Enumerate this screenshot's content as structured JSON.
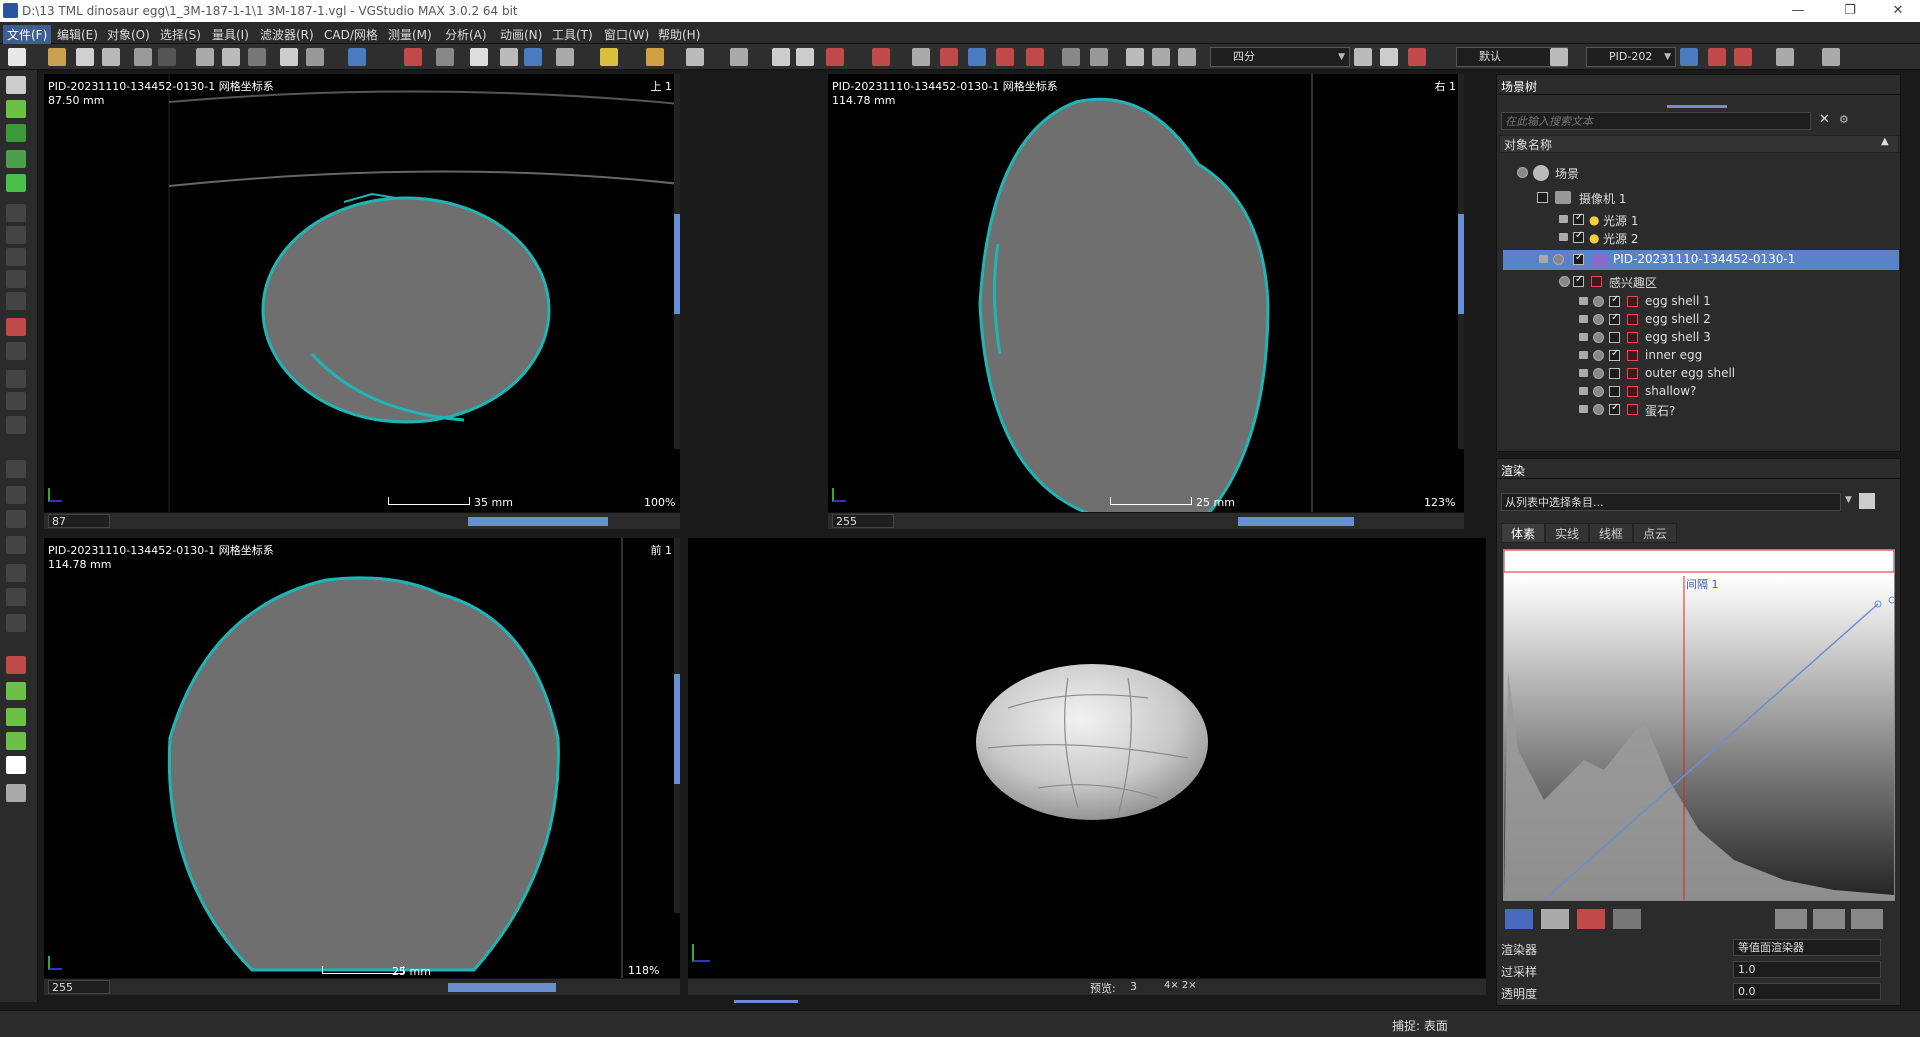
{
  "window": {
    "title": "D:\\13 TML dinosaur egg\\1_3M-187-1-1\\1 3M-187-1.vgl - VGStudio MAX 3.0.2 64 bit",
    "minimize": "—",
    "restore": "❐",
    "close": "✕"
  },
  "menu": [
    {
      "label": "文件(F)",
      "active": true
    },
    {
      "label": "编辑(E)"
    },
    {
      "label": "对象(O)"
    },
    {
      "label": "选择(S)"
    },
    {
      "label": "量具(I)"
    },
    {
      "label": "滤波器(R)"
    },
    {
      "label": "CAD/网格"
    },
    {
      "label": "测量(M)"
    },
    {
      "label": "分析(A)"
    },
    {
      "label": "动画(N)"
    },
    {
      "label": "工具(T)"
    },
    {
      "label": "窗口(W)"
    },
    {
      "label": "帮助(H)"
    }
  ],
  "toolbar": {
    "layout_select": "四分",
    "preset_select": "默认",
    "object_select": "PID-202"
  },
  "viewports": {
    "top": {
      "header": "PID-20231110-134452-0130-1 网格坐标系",
      "direction": "上 1",
      "distance": "87.50 mm",
      "scale": "35 mm",
      "zoom": "100%",
      "slice": "87"
    },
    "right": {
      "header": "PID-20231110-134452-0130-1 网格坐标系",
      "direction": "右 1",
      "distance": "114.78 mm",
      "scale": "25 mm",
      "zoom": "123%",
      "slice": "255"
    },
    "front": {
      "header": "PID-20231110-134452-0130-1 网格坐标系",
      "direction": "前 1",
      "distance": "114.78 mm",
      "scale": "25 mm",
      "zoom": "118%",
      "slice": "255"
    },
    "three_d": {
      "preview_label": "预览:",
      "preview_value": "3",
      "multiplier": "4× 2×"
    }
  },
  "scene_tree": {
    "title": "场景树",
    "search_placeholder": "在此输入搜索文本",
    "column": "对象名称",
    "items": [
      {
        "label": "场景",
        "type": "scene"
      },
      {
        "label": "摄像机 1",
        "type": "camera"
      },
      {
        "label": "光源 1",
        "type": "light",
        "checked": true
      },
      {
        "label": "光源 2",
        "type": "light",
        "checked": true
      },
      {
        "label": "PID-20231110-134452-0130-1",
        "type": "volume",
        "checked": true,
        "selected": true
      },
      {
        "label": "感兴趣区",
        "type": "roi-group",
        "checked": true
      },
      {
        "label": "egg shell 1",
        "type": "roi",
        "checked": true
      },
      {
        "label": "egg shell 2",
        "type": "roi",
        "checked": true
      },
      {
        "label": "egg shell 3",
        "type": "roi",
        "checked": false
      },
      {
        "label": "inner egg",
        "type": "roi",
        "checked": true
      },
      {
        "label": "outer egg shell",
        "type": "roi",
        "checked": false
      },
      {
        "label": "shallow?",
        "type": "roi",
        "checked": false
      },
      {
        "label": "蛋石?",
        "type": "roi",
        "checked": true
      }
    ]
  },
  "render_panel": {
    "title": "渲染",
    "preset_placeholder": "从列表中选择条目...",
    "tabs": [
      {
        "label": "体素",
        "active": true
      },
      {
        "label": "实线"
      },
      {
        "label": "线框"
      },
      {
        "label": "点云"
      }
    ],
    "interval_label": "间隔 1",
    "props": [
      {
        "label": "渲染器",
        "value": "等值面渲染器"
      },
      {
        "label": "过采样",
        "value": "1.0"
      },
      {
        "label": "透明度",
        "value": "0.0"
      }
    ]
  },
  "status": {
    "snap": "捕捉: 表面"
  },
  "colors": {
    "accent": "#6a8fd0",
    "selection": "#5a82c8",
    "roi_outline": "#1fb5b5",
    "background": "#1a1a1a"
  }
}
